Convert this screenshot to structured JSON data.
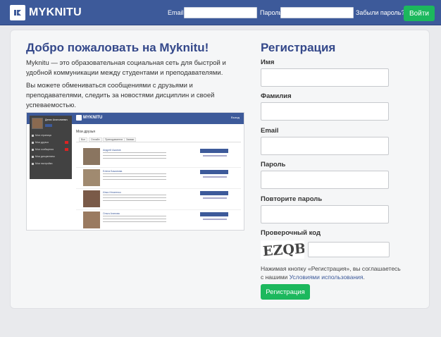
{
  "header": {
    "logo_text": "MYKNITU",
    "email_label": "Email",
    "password_label": "Пароль",
    "forgot_link": "Забыли пароль?",
    "login_button": "Войти",
    "email_value": "",
    "password_value": ""
  },
  "welcome": {
    "title": "Добро пожаловать на Myknitu!",
    "paragraph1": "Myknitu — это образовательная социальная сеть для быстрой и удобной коммуникации между студентами и преподавателями.",
    "paragraph2": "Вы можете обмениваться сообщениями с друзьями и преподавателями, следить за новостями дисциплин и своей успеваемостью."
  },
  "preview": {
    "logo_text": "MYKNITU",
    "exit": "Выход",
    "user_name": "Денис Анатолиевич",
    "menu": [
      "Моя страница",
      "Мои друзья",
      "Мои сообщения",
      "Мои дисциплины",
      "Мои настройки"
    ],
    "heading": "Мои друзья",
    "tabs": [
      "Все",
      "Онлайн",
      "Преподаватели",
      "Заявки"
    ],
    "rows": [
      {
        "name": "Андрей Ажанов"
      },
      {
        "name": "Елена Бажанова"
      },
      {
        "name": "Илья Игнатенко"
      },
      {
        "name": "Ольга Агапова"
      }
    ]
  },
  "registration": {
    "title": "Регистрация",
    "fields": [
      {
        "label": "Имя",
        "value": ""
      },
      {
        "label": "Фамилия",
        "value": ""
      },
      {
        "label": "Email",
        "value": ""
      },
      {
        "label": "Пароль",
        "value": ""
      },
      {
        "label": "Повторите пароль",
        "value": ""
      }
    ],
    "captcha_label": "Проверочный код",
    "captcha_text": "EZQB",
    "captcha_value": "",
    "agree_prefix": "Нажимая кнопку «Регистрация», вы соглашаетесь с нашими ",
    "agree_link": "Условиями использования",
    "agree_suffix": ".",
    "submit_label": "Регистрация"
  },
  "colors": {
    "brand": "#3d5a9a",
    "accent_green": "#1cb85d",
    "title_blue": "#34488a"
  }
}
